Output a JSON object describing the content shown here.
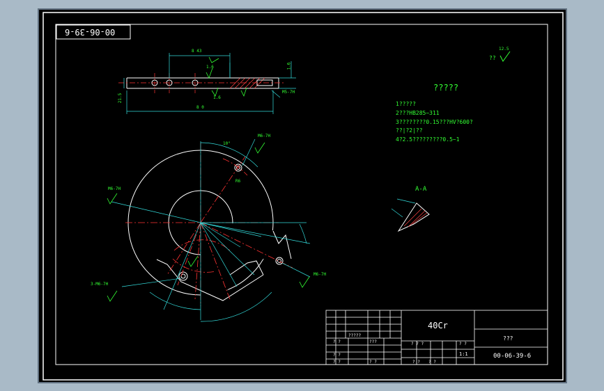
{
  "drawing": {
    "stamp_mirrored": "00-06-39-6",
    "tech_title": "?????",
    "tech_notes": [
      "1?????",
      "2???HB285~311",
      "3????????0.15???HV?600?",
      "??|?2|??",
      "4?2.5?????????0.5~1"
    ],
    "roughness_note": "??",
    "roughness_value": "12.5",
    "section_label": "A-A",
    "dimensions": {
      "top_width": "8 0",
      "top_hole_span": "8 43",
      "top_small": "1.6",
      "thickness": "1.6",
      "side": "21.5",
      "depth": "1.6",
      "angle_top": "10°",
      "r_outer": "R6",
      "note_left": "M6-7H",
      "note_right": "M6-7H",
      "note_bottom_right": "M6-7H",
      "thread_top": "M5-7H",
      "bottom_left_note": "3-M6-7H"
    }
  },
  "title_block": {
    "material": "40Cr",
    "drawing_no": "00-06-39-6",
    "name": "???",
    "scale": "1:1",
    "small_cells": [
      "? ?",
      "? ?",
      "?????",
      "???",
      "? ? ?",
      "? ?",
      "? ?",
      "? ?",
      "? ?",
      "? ?",
      "? ?",
      "? ?"
    ]
  }
}
